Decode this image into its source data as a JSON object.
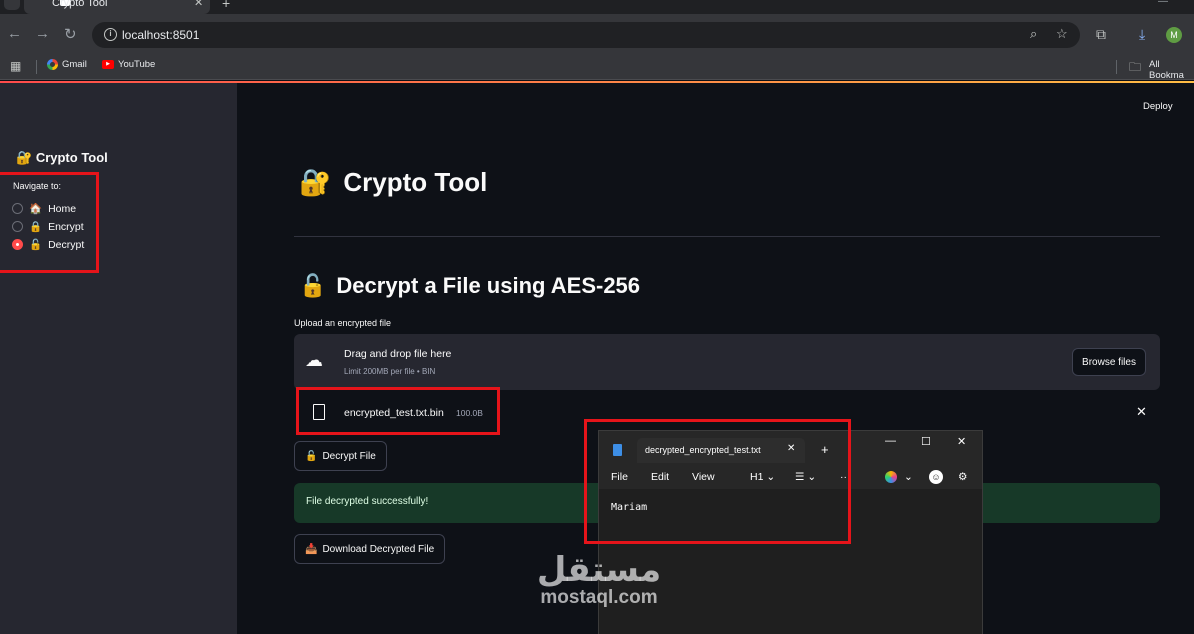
{
  "browser": {
    "tab_title": "Crypto Tool",
    "url": "localhost:8501",
    "bookmarks": [
      "Gmail",
      "YouTube"
    ],
    "all_bookmarks": "All Bookma",
    "profile_initial": "M"
  },
  "app": {
    "deploy_label": "Deploy",
    "sidebar": {
      "title": "Crypto Tool",
      "nav_label": "Navigate to:",
      "options": [
        {
          "icon": "🏠",
          "label": "Home",
          "selected": false
        },
        {
          "icon": "🔒",
          "label": "Encrypt",
          "selected": false
        },
        {
          "icon": "🔓",
          "label": "Decrypt",
          "selected": true
        }
      ]
    },
    "main": {
      "title_icon": "🔐",
      "title": "Crypto Tool",
      "subtitle_icon": "🔓",
      "subtitle": "Decrypt a File using AES-256",
      "upload_label": "Upload an encrypted file",
      "dropzone_main": "Drag and drop file here",
      "dropzone_sub": "Limit 200MB per file • BIN",
      "browse_label": "Browse files",
      "file_name": "encrypted_test.txt.bin",
      "file_size": "100.0B",
      "decrypt_icon": "🔓",
      "decrypt_label": "Decrypt File",
      "success_message": "File decrypted successfully!",
      "download_icon": "📥",
      "download_label": "Download Decrypted File"
    }
  },
  "notepad": {
    "tab_title": "decrypted_encrypted_test.txt",
    "menu": [
      "File",
      "Edit",
      "View"
    ],
    "heading_label": "H1",
    "content": "Mariam"
  },
  "watermark": {
    "arabic": "مستقل",
    "english": "mostaql.com"
  },
  "colors": {
    "accent": "#ff4b4b",
    "sidebar_bg": "#262730",
    "main_bg": "#0e1117",
    "success_bg": "#173928",
    "highlight": "#e5141a"
  }
}
